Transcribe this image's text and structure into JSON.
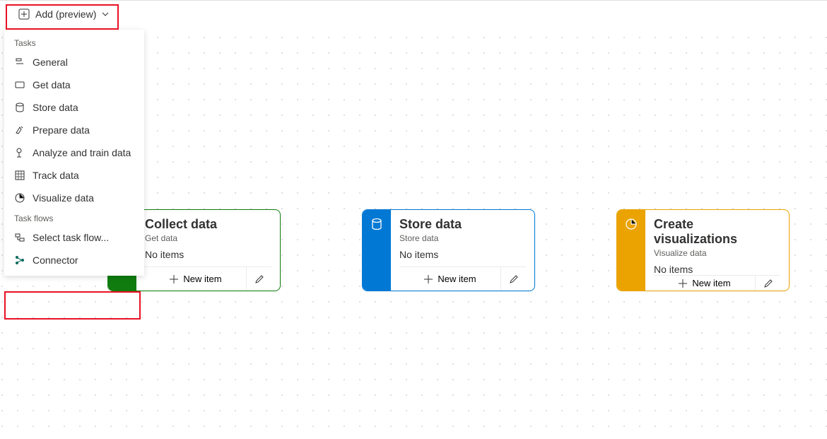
{
  "toolbar": {
    "add_label": "Add (preview)"
  },
  "dropdown": {
    "section_tasks": "Tasks",
    "section_flows": "Task flows",
    "items_tasks": {
      "general": "General",
      "get_data": "Get data",
      "store_data": "Store data",
      "prepare_data": "Prepare data",
      "analyze": "Analyze and train data",
      "track": "Track data",
      "visualize": "Visualize data"
    },
    "items_flows": {
      "select_flow": "Select task flow...",
      "connector": "Connector"
    }
  },
  "cards": {
    "collect": {
      "title": "Collect data",
      "sub": "Get data",
      "empty": "No items"
    },
    "store": {
      "title": "Store data",
      "sub": "Store data",
      "empty": "No items"
    },
    "viz": {
      "title": "Create visualizations",
      "sub": "Visualize data",
      "empty": "No items"
    },
    "new_item_label": "New item"
  }
}
